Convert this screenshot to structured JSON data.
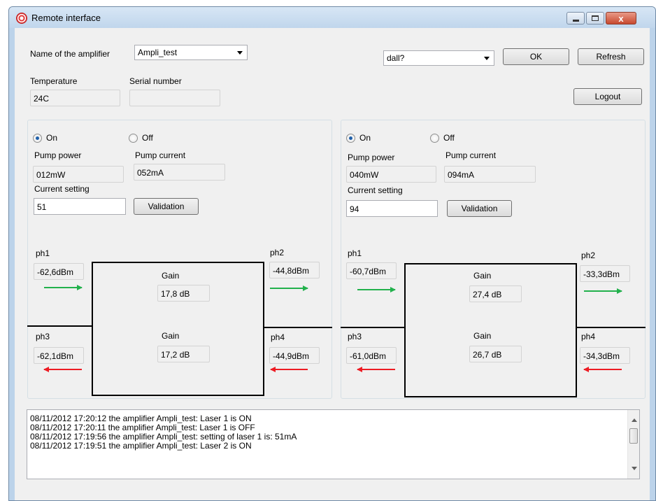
{
  "window": {
    "title": "Remote interface",
    "close_glyph": "x"
  },
  "header": {
    "amp_name_label": "Name of the amplifier",
    "amp_name_value": "Ampli_test",
    "device_value": "dall?",
    "ok_label": "OK",
    "refresh_label": "Refresh",
    "temperature_label": "Temperature",
    "temperature_value": "24C",
    "serial_label": "Serial number",
    "serial_value": "",
    "logout_label": "Logout"
  },
  "panels": [
    {
      "on_label": "On",
      "off_label": "Off",
      "on_selected": true,
      "pump_power_label": "Pump power",
      "pump_power_value": "012mW",
      "pump_current_label": "Pump current",
      "pump_current_value": "052mA",
      "current_setting_label": "Current setting",
      "current_setting_value": "51",
      "validation_label": "Validation",
      "ph1_label": "ph1",
      "ph1_value": "-62,6dBm",
      "ph2_label": "ph2",
      "ph2_value": "-44,8dBm",
      "ph3_label": "ph3",
      "ph3_value": "-62,1dBm",
      "ph4_label": "ph4",
      "ph4_value": "-44,9dBm",
      "gain1_label": "Gain",
      "gain1_value": "17,8 dB",
      "gain2_label": "Gain",
      "gain2_value": "17,2 dB"
    },
    {
      "on_label": "On",
      "off_label": "Off",
      "on_selected": true,
      "pump_power_label": "Pump power",
      "pump_power_value": "040mW",
      "pump_current_label": "Pump current",
      "pump_current_value": "094mA",
      "current_setting_label": "Current setting",
      "current_setting_value": "94",
      "validation_label": "Validation",
      "ph1_label": "ph1",
      "ph1_value": "-60,7dBm",
      "ph2_label": "ph2",
      "ph2_value": "-33,3dBm",
      "ph3_label": "ph3",
      "ph3_value": "-61,0dBm",
      "ph4_label": "ph4",
      "ph4_value": "-34,3dBm",
      "gain1_label": "Gain",
      "gain1_value": "27,4 dB",
      "gain2_label": "Gain",
      "gain2_value": "26,7 dB"
    }
  ],
  "colors": {
    "forward_arrow": "#22b14c",
    "backward_arrow": "#ed1c24"
  },
  "log": {
    "lines": [
      "08/11/2012 17:20:12 the amplifier Ampli_test: Laser 1 is ON",
      "08/11/2012 17:20:11 the amplifier Ampli_test: Laser 1 is OFF",
      "08/11/2012 17:19:56 the amplifier Ampli_test: setting of laser 1 is: 51mA",
      "08/11/2012 17:19:51 the amplifier Ampli_test: Laser 2 is ON"
    ]
  }
}
